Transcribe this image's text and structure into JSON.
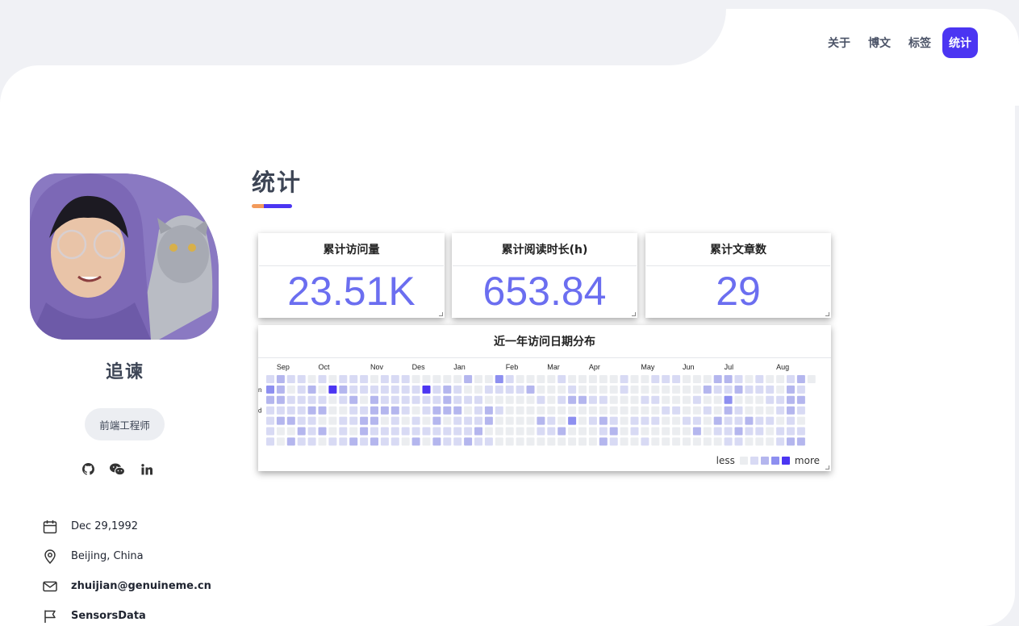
{
  "nav": [
    {
      "label": "关于",
      "active": false
    },
    {
      "label": "博文",
      "active": false
    },
    {
      "label": "标签",
      "active": false
    },
    {
      "label": "统计",
      "active": true
    }
  ],
  "profile": {
    "name": "追谏",
    "role": "前端工程师",
    "social_icons": [
      "github-icon",
      "wechat-icon",
      "linkedin-icon"
    ],
    "info": [
      {
        "icon": "calendar-icon",
        "text": "Dec 29,1992",
        "bold": false
      },
      {
        "icon": "location-icon",
        "text": "Beijing, China",
        "bold": false
      },
      {
        "icon": "mail-icon",
        "text": "zhuijian@genuineme.cn",
        "bold": true
      },
      {
        "icon": "flag-icon",
        "text": "SensorsData",
        "bold": true
      }
    ]
  },
  "page": {
    "title": "统计"
  },
  "stats": [
    {
      "label": "累计访问量",
      "value": "23.51K"
    },
    {
      "label": "累计阅读时长(h)",
      "value": "653.84"
    },
    {
      "label": "累计文章数",
      "value": "29"
    }
  ],
  "heatmap": {
    "title": "近一年访问日期分布",
    "months": [
      "Sep",
      "Oct",
      "Nov",
      "Des",
      "Jan",
      "Feb",
      "Mar",
      "Apr",
      "May",
      "Jun",
      "Jul",
      "Aug"
    ],
    "weekday_labels": [
      "n",
      "d"
    ],
    "legend_less": "less",
    "legend_more": "more",
    "colors": [
      "#ebedf0",
      "#d8daf4",
      "#b4b6ee",
      "#8d8ff0",
      "#4b35f2"
    ]
  }
}
